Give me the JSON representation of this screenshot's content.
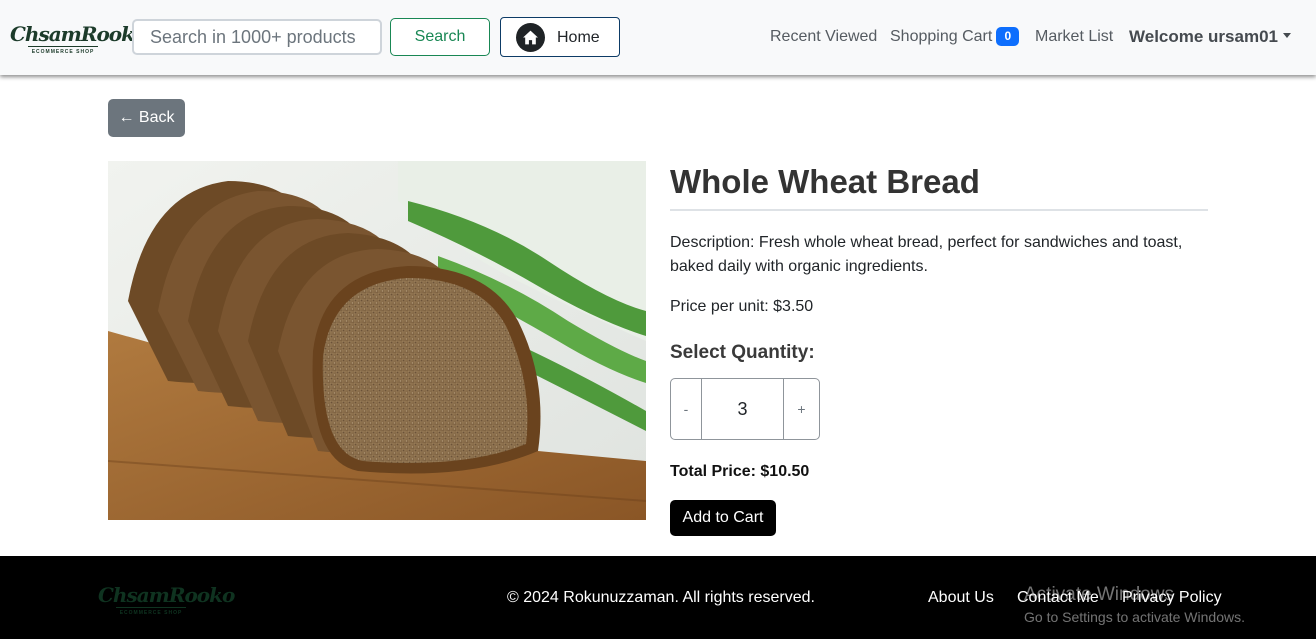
{
  "brand": {
    "logo_text": "ChsamRooko",
    "logo_tagline": "ECOMMERCE SHOP"
  },
  "navbar": {
    "search": {
      "placeholder": "Search in 1000+ products",
      "value": ""
    },
    "search_button": "Search",
    "home_button": "Home",
    "links": {
      "recent": "Recent Viewed",
      "cart": "Shopping Cart",
      "market": "Market List"
    },
    "cart_count": "0",
    "user_menu": "Welcome ursam01"
  },
  "page": {
    "back_button": "← Back",
    "product": {
      "title": "Whole Wheat Bread",
      "description": "Description: Fresh whole wheat bread, perfect for sandwiches and toast, baked daily with organic ingredients.",
      "price_line": "Price per unit: $3.50",
      "quantity_heading": "Select Quantity:",
      "minus_label": "-",
      "plus_label": "+",
      "quantity": "3",
      "total_line": "Total Price: $10.50",
      "add_to_cart": "Add to Cart"
    }
  },
  "footer": {
    "copyright": "© 2024 Rokunuzzaman. All rights reserved.",
    "links": {
      "about": "About Us",
      "contact": "Contact Me",
      "privacy": "Privacy Policy"
    }
  },
  "os_watermark": {
    "title": "Activate Windows",
    "subtitle": "Go to Settings to activate Windows."
  },
  "colors": {
    "navbar_bg": "#f8f9fa",
    "search_accent": "#198754",
    "badge": "#0d6efd",
    "back_button": "#6c757d",
    "footer_bg": "#000000"
  },
  "icons": {
    "home": "home-icon",
    "user_caret": "chevron-down-icon"
  }
}
